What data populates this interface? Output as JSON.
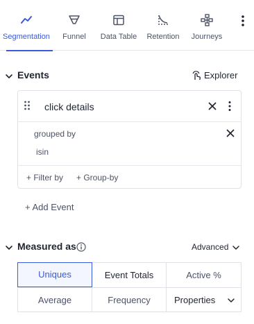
{
  "tabs": [
    {
      "label": "Segmentation",
      "icon": "segmentation-icon",
      "active": true
    },
    {
      "label": "Funnel",
      "icon": "funnel-icon",
      "active": false
    },
    {
      "label": "Data Table",
      "icon": "data-table-icon",
      "active": false
    },
    {
      "label": "Retention",
      "icon": "retention-icon",
      "active": false
    },
    {
      "label": "Journeys",
      "icon": "journeys-icon",
      "active": false
    }
  ],
  "events": {
    "title": "Events",
    "explorer_label": "Explorer",
    "items": [
      {
        "name": "click details",
        "grouped_by_label": "grouped by",
        "group_value": "isin",
        "filter_label": "+ Filter by",
        "groupby_label": "+ Group-by"
      }
    ],
    "add_event_label": "+ Add Event"
  },
  "measured_as": {
    "title": "Measured as",
    "advanced_label": "Advanced",
    "options": [
      "Uniques",
      "Event Totals",
      "Active %",
      "Average",
      "Frequency",
      "Properties"
    ],
    "selected": "Uniques"
  },
  "colors": {
    "accent": "#3a5ad9",
    "text": "#1f2430",
    "muted_text": "#4c5365",
    "border": "#dfe2e8"
  }
}
